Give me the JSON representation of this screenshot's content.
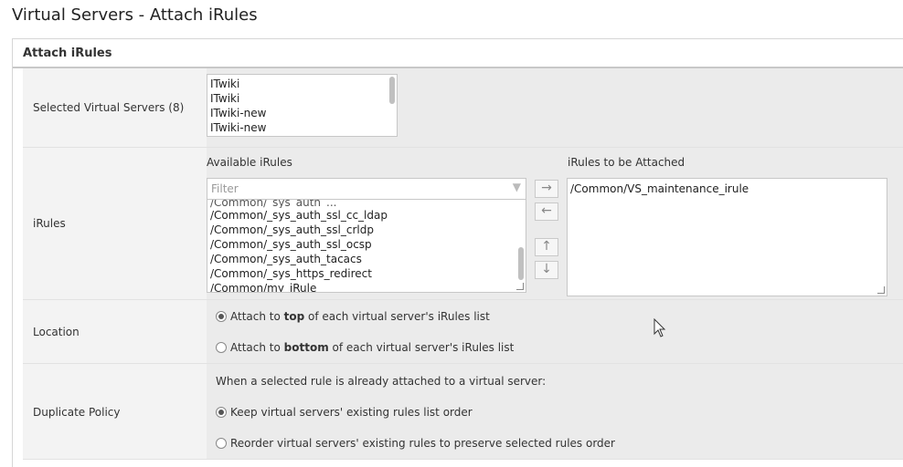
{
  "page": {
    "title": "Virtual Servers - Attach iRules"
  },
  "section": {
    "title": "Attach iRules"
  },
  "rows": {
    "selected": {
      "label": "Selected Virtual Servers (8)",
      "items": [
        "ITwiki",
        "ITwiki",
        "ITwiki-new",
        "ITwiki-new"
      ]
    },
    "irules": {
      "label": "iRules",
      "available_label": "Available iRules",
      "filter_placeholder": "Filter",
      "partial_item": "/Common/_sys_auth_...",
      "available_items": [
        "/Common/_sys_auth_ssl_cc_ldap",
        "/Common/_sys_auth_ssl_crldp",
        "/Common/_sys_auth_ssl_ocsp",
        "/Common/_sys_auth_tacacs",
        "/Common/_sys_https_redirect",
        "/Common/my_iRule"
      ],
      "attached_label": "iRules to be Attached",
      "attached_items": [
        "/Common/VS_maintenance_irule"
      ],
      "icons": {
        "filter": "filter-icon",
        "add": "arrow-right-icon",
        "remove": "arrow-left-icon",
        "up": "arrow-up-icon",
        "down": "arrow-down-icon"
      }
    },
    "location": {
      "label": "Location",
      "options": [
        {
          "prefix": "Attach to ",
          "bold": "top",
          "suffix": " of each virtual server's iRules list",
          "checked": true
        },
        {
          "prefix": "Attach to ",
          "bold": "bottom",
          "suffix": " of each virtual server's iRules list",
          "checked": false
        }
      ]
    },
    "duplicate": {
      "label": "Duplicate Policy",
      "description": "When a selected rule is already attached to a virtual server:",
      "options": [
        {
          "text": "Keep virtual servers' existing rules list order",
          "checked": true
        },
        {
          "text": "Reorder virtual servers' existing rules to preserve selected rules order",
          "checked": false
        }
      ]
    }
  }
}
